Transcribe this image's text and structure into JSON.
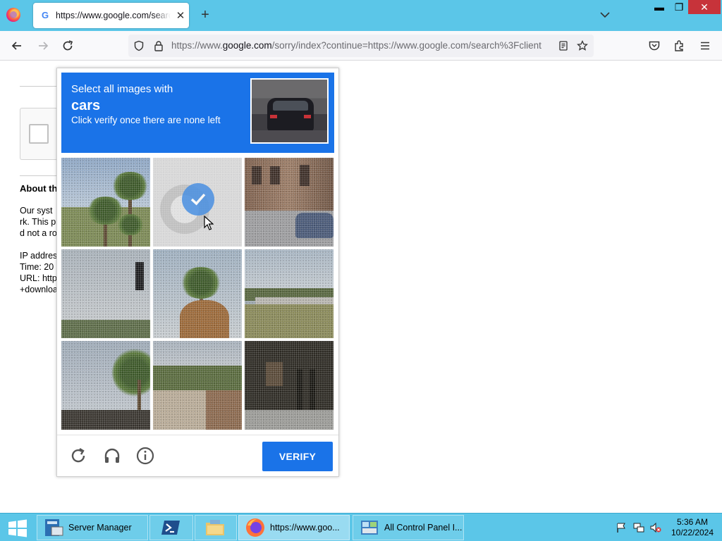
{
  "browser": {
    "tab_title": "https://www.google.com/search",
    "tab_close": "✕",
    "new_tab": "+",
    "url_prefix": "https://www.",
    "url_domain": "google.com",
    "url_rest": "/sorry/index?continue=https://www.google.com/search%3Fclient"
  },
  "window_controls": {
    "minimize": "▬",
    "maximize": "❐",
    "close": "✕"
  },
  "page": {
    "about_heading": "About th",
    "lines_a": [
      "Our syst",
      "rk. This p",
      "d not a ro"
    ],
    "lines_b": [
      "IP addres",
      "Time: 20",
      "URL: http",
      "+downloa"
    ]
  },
  "captcha": {
    "instruction_1": "Select all images with",
    "target": "cars",
    "instruction_2": "Click verify once there are none left",
    "verify_label": "VERIFY",
    "tiles": [
      {
        "name": "palm-trees",
        "selected": false
      },
      {
        "name": "car-wheel",
        "selected": true
      },
      {
        "name": "street-buildings-car",
        "selected": false
      },
      {
        "name": "traffic-light",
        "selected": false
      },
      {
        "name": "palm-tree-building",
        "selected": false
      },
      {
        "name": "bridge",
        "selected": false
      },
      {
        "name": "palm-roof",
        "selected": false
      },
      {
        "name": "wall-trees",
        "selected": false
      },
      {
        "name": "dark-trees-sign",
        "selected": false
      }
    ],
    "colors": {
      "header_blue": "#1a73e8",
      "check_blue": "#4a90e2"
    }
  },
  "taskbar": {
    "items": [
      {
        "label": "Server Manager",
        "icon": "server-manager-icon"
      },
      {
        "label": "",
        "icon": "powershell-icon"
      },
      {
        "label": "",
        "icon": "file-explorer-icon"
      },
      {
        "label": "https://www.goo...",
        "icon": "firefox-icon"
      },
      {
        "label": "All Control Panel I...",
        "icon": "control-panel-icon"
      }
    ],
    "time": "5:36 AM",
    "date": "10/22/2024"
  }
}
